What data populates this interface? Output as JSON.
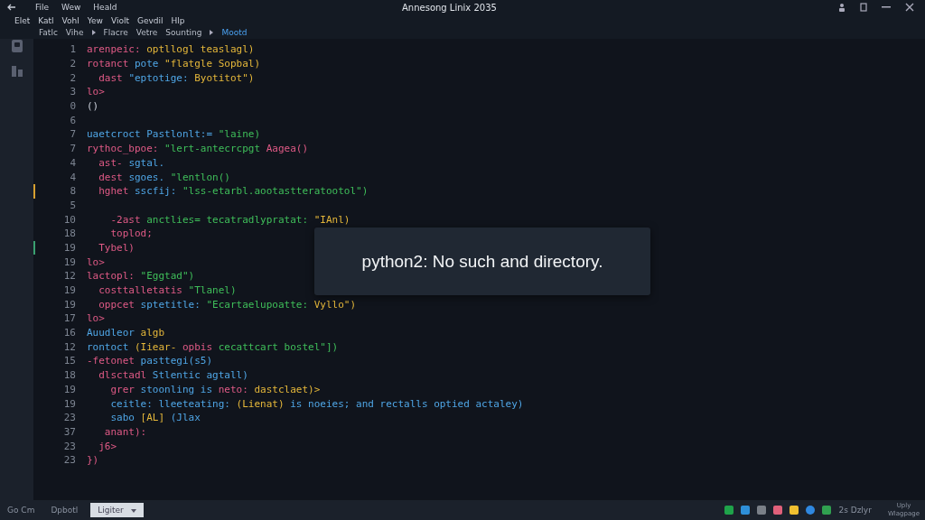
{
  "window": {
    "title": "Annesong Linix 2035",
    "menu": [
      "File",
      "Wew",
      "Heald"
    ]
  },
  "menu_bar": [
    "Elet",
    "Katl",
    "Vohl",
    "Yew",
    "Violt",
    "Gevdil",
    "Hlp"
  ],
  "breadcrumb": [
    {
      "label": "Fatlc",
      "selected": false
    },
    {
      "label": "Vihe",
      "selected": false
    },
    {
      "label": "Flacre",
      "selected": false
    },
    {
      "label": "Vetre",
      "selected": false
    },
    {
      "label": "Sounting",
      "selected": false
    },
    {
      "label": "Mootd",
      "selected": true
    }
  ],
  "editor": {
    "lines": [
      {
        "number": "1",
        "tokens": [
          {
            "kind": "keyword",
            "text": "arenpeic:"
          },
          {
            "kind": "literal",
            "text": "optllogl teaslagl)"
          }
        ]
      },
      {
        "number": "2",
        "tokens": [
          {
            "kind": "keyword",
            "text": "rotanct"
          },
          {
            "kind": "name",
            "text": "pote"
          },
          {
            "kind": "literal",
            "text": "\"flatgle Sopbal)"
          }
        ]
      },
      {
        "number": "2",
        "tokens": [
          {
            "kind": "keyword",
            "text": "  dast"
          },
          {
            "kind": "name",
            "text": "\"eptotige:"
          },
          {
            "kind": "literal",
            "text": "Byotitot\")"
          }
        ]
      },
      {
        "number": "3",
        "tokens": [
          {
            "kind": "keyword",
            "text": "lo>"
          }
        ]
      },
      {
        "number": "0",
        "tokens": [
          {
            "kind": "plain",
            "text": "()"
          }
        ]
      },
      {
        "number": "6"
      },
      {
        "number": "7",
        "tokens": [
          {
            "kind": "name",
            "text": "uaetcroct Pastlonlt:="
          },
          {
            "kind": "string",
            "text": "\"laine)"
          }
        ]
      },
      {
        "number": "7",
        "tokens": [
          {
            "kind": "keyword",
            "text": "rythoc_bpoe:"
          },
          {
            "kind": "string",
            "text": "\"lert-antecrcpgt"
          },
          {
            "kind": "keyword",
            "text": "Aagea()"
          }
        ]
      },
      {
        "number": "4",
        "tokens": [
          {
            "kind": "keyword",
            "text": "  ast-"
          },
          {
            "kind": "name",
            "text": "sgtal."
          }
        ]
      },
      {
        "number": "4",
        "tokens": [
          {
            "kind": "keyword",
            "text": "  dest"
          },
          {
            "kind": "name",
            "text": "sgoes."
          },
          {
            "kind": "string",
            "text": "\"lentlon()"
          }
        ]
      },
      {
        "number": "8",
        "marker": {
          "color": "#d6a030"
        },
        "tokens": [
          {
            "kind": "keyword",
            "text": "  hghet"
          },
          {
            "kind": "name",
            "text": "sscfij:"
          },
          {
            "kind": "string",
            "text": "\"lss-etarbl.aootastteratootol\")"
          }
        ]
      },
      {
        "number": "5"
      },
      {
        "number": "10",
        "tokens": [
          {
            "kind": "keyword",
            "text": "    -2ast"
          },
          {
            "kind": "string",
            "text": "anctlies= tecatradlypratat:"
          },
          {
            "kind": "literal",
            "text": "\"IAnl)"
          }
        ]
      },
      {
        "number": "18",
        "tokens": [
          {
            "kind": "keyword",
            "text": "    toplod;"
          }
        ]
      },
      {
        "number": "19",
        "marker": {
          "color": "#3aa070"
        },
        "tokens": [
          {
            "kind": "keyword",
            "text": "  Tybel)"
          }
        ]
      },
      {
        "number": "19",
        "tokens": [
          {
            "kind": "keyword",
            "text": "lo>"
          }
        ]
      },
      {
        "number": "12",
        "tokens": [
          {
            "kind": "keyword",
            "text": "lactopl:"
          },
          {
            "kind": "string",
            "text": "\"Eggtad\")"
          }
        ]
      },
      {
        "number": "19",
        "tokens": [
          {
            "kind": "keyword",
            "text": "  costtalletatis"
          },
          {
            "kind": "string",
            "text": "\"Tlanel)"
          }
        ]
      },
      {
        "number": "19",
        "tokens": [
          {
            "kind": "keyword",
            "text": "  oppcet"
          },
          {
            "kind": "name",
            "text": "sptetitle:"
          },
          {
            "kind": "string",
            "text": "\"Ecartaelupoatte:"
          },
          {
            "kind": "literal",
            "text": "Vyllo\")"
          }
        ]
      },
      {
        "number": "17",
        "tokens": [
          {
            "kind": "keyword",
            "text": "lo>"
          }
        ]
      },
      {
        "number": "16",
        "tokens": [
          {
            "kind": "name",
            "text": "Auudleor"
          },
          {
            "kind": "literal",
            "text": "algb"
          }
        ]
      },
      {
        "number": "12",
        "tokens": [
          {
            "kind": "name",
            "text": "rontoct"
          },
          {
            "kind": "literal",
            "text": "(Iiear-"
          },
          {
            "kind": "keyword",
            "text": "opbis"
          },
          {
            "kind": "string",
            "text": "cecattcart bostel\"])"
          }
        ]
      },
      {
        "number": "15",
        "tokens": [
          {
            "kind": "keyword",
            "text": "-fetonet"
          },
          {
            "kind": "name",
            "text": "pasttegi(s5)"
          }
        ]
      },
      {
        "number": "18",
        "tokens": [
          {
            "kind": "keyword",
            "text": "  dlsctadl"
          },
          {
            "kind": "name",
            "text": "Stlentic agtall)"
          }
        ]
      },
      {
        "number": "19",
        "tokens": [
          {
            "kind": "keyword",
            "text": "    grer"
          },
          {
            "kind": "name",
            "text": "stoonling is"
          },
          {
            "kind": "keyword",
            "text": "neto:"
          },
          {
            "kind": "literal",
            "text": "dastclaet)>"
          }
        ]
      },
      {
        "number": "19",
        "tokens": [
          {
            "kind": "name",
            "text": "    ceitle: lleeteating:"
          },
          {
            "kind": "literal",
            "text": "(Lienat)"
          },
          {
            "kind": "name",
            "text": "is noeies; and rectalls optied actaley)"
          }
        ]
      },
      {
        "number": "23",
        "tokens": [
          {
            "kind": "name",
            "text": "    sabo"
          },
          {
            "kind": "literal",
            "text": "[AL]"
          },
          {
            "kind": "name",
            "text": "(Jlax"
          }
        ]
      },
      {
        "number": "37",
        "tokens": [
          {
            "kind": "keyword",
            "text": "   anant):"
          }
        ]
      },
      {
        "number": "23",
        "tokens": [
          {
            "kind": "keyword",
            "text": "  j6>"
          }
        ]
      },
      {
        "number": "23",
        "tokens": [
          {
            "kind": "keyword",
            "text": "})"
          }
        ]
      }
    ]
  },
  "notification": {
    "message": "python2: No such and directory."
  },
  "status_bar": {
    "items": [
      {
        "label": "Go Cm",
        "selected": false
      },
      {
        "label": "Dpbotl",
        "selected": false
      },
      {
        "label": "Ligiter",
        "selected": true
      }
    ],
    "tray": [
      {
        "color": "#1fa34a"
      },
      {
        "color": "#2e8fd8"
      },
      {
        "color": "#7a8088"
      },
      {
        "color": "#e0607a"
      },
      {
        "color": "#f0c030"
      },
      {
        "color": "#2f88e0"
      },
      {
        "color": "#30a050"
      }
    ],
    "tray_label": "2s Dzlyr",
    "clock": [
      "Uply",
      "Wlagpage"
    ]
  }
}
